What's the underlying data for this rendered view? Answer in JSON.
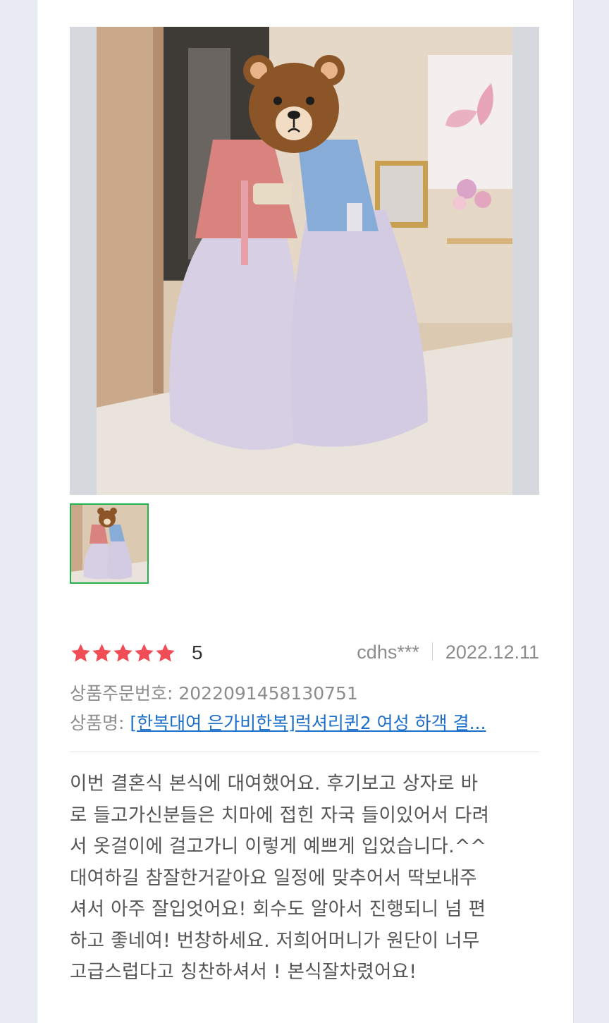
{
  "review": {
    "photo": {
      "alt": "hanbok-photo",
      "colors": {
        "floor": "#e8e2da",
        "wall": "#d9c5ae",
        "skirt": "#d8d0e6",
        "jeogori_left": "#d9807c",
        "jeogori_right": "#7fa6d3",
        "bear": "#8b5528"
      }
    },
    "thumbnail": {
      "selected": true,
      "border_color": "#22b14c"
    },
    "rating": {
      "stars": 5,
      "star_color": "#f04d57",
      "score_label": "5"
    },
    "author": "cdhs***",
    "date": "2022.12.11",
    "order_number_label": "상품주문번호: 2022091458130751",
    "product_label": "상품명: ",
    "product_name": "[한복대여 은가비한복]럭셔리퀸2 여성 하객 결...",
    "body_lines": [
      "이번 결혼식 본식에 대여했어요. 후기보고 상자로 바",
      "로 들고가신분들은 치마에 접힌 자국 들이있어서 다려",
      "서 옷걸이에 걸고가니 이렇게 예쁘게 입었습니다.^^",
      "대여하길 참잘한거같아요 일정에 맞추어서 딱보내주",
      "셔서 아주 잘입엇어요! 회수도 알아서 진행되니 넘 편",
      "하고 좋네여! 번창하세요. 저희어머니가 원단이 너무",
      "고급스럽다고 칭찬하셔서 ! 본식잘차렸어요!"
    ]
  }
}
